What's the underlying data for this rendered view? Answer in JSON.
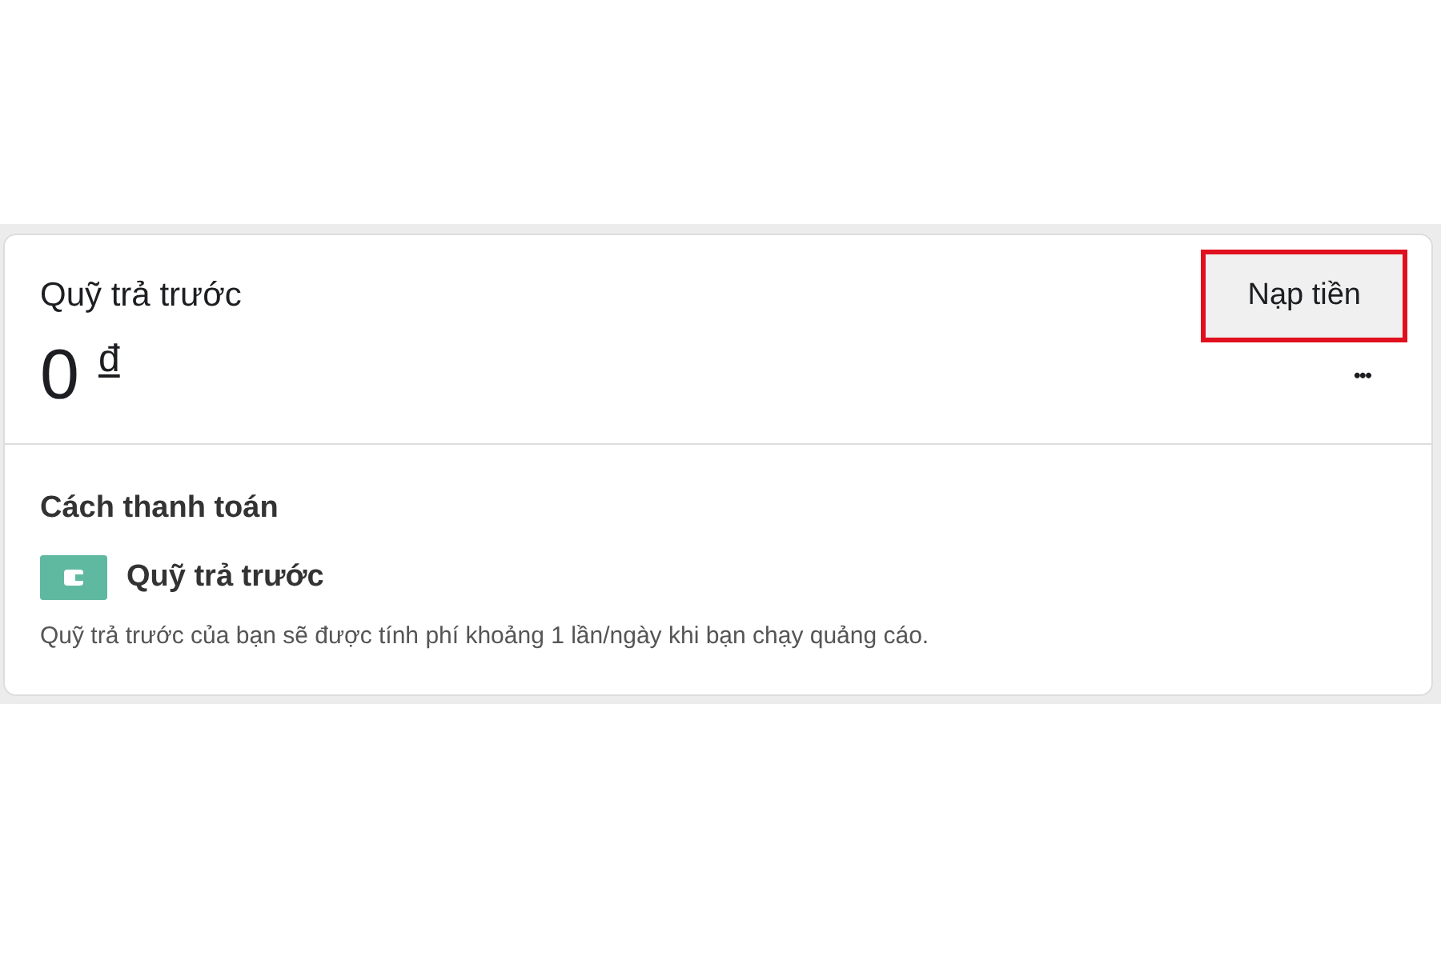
{
  "balance_card": {
    "title": "Quỹ trả trước",
    "top_up_button": {
      "label": "Nạp tiền",
      "highlighted": true
    },
    "amount": "0",
    "currency": "đ",
    "more_button": "•••"
  },
  "payment_method": {
    "heading": "Cách thanh toán",
    "method": "Quỹ trả trước",
    "description": "Quỹ trả trước của bạn sẽ được tính phí khoảng 1 lần/ngày khi bạn chạy quảng cáo."
  }
}
